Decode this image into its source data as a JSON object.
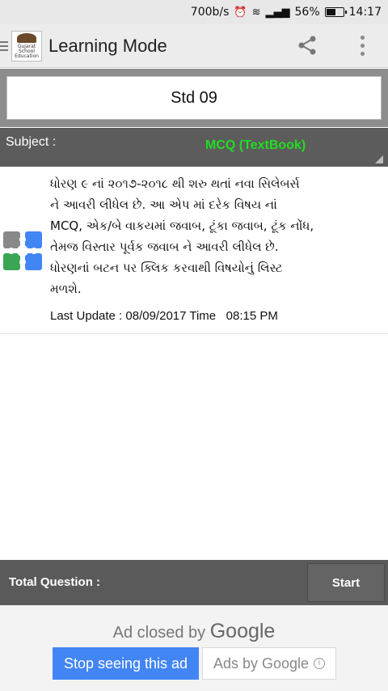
{
  "status_bar": {
    "speed": "700b/s",
    "battery": "56%",
    "battery_level": 0.56,
    "time": "14:17"
  },
  "app_bar": {
    "logo_text": "Gujarat School Education",
    "title": "Learning Mode",
    "icons": [
      "menu-icon",
      "share-icon",
      "overflow-menu-icon"
    ]
  },
  "std_selector": {
    "value": "Std 09"
  },
  "subject": {
    "label": "Subject :",
    "value": "MCQ  (TextBook)",
    "value_color": "#22dd22"
  },
  "list_item": {
    "icon": "puzzle-icon",
    "description": "ધોરણ ૯ નાં ૨૦૧૭-૨૦૧૮ થી શરુ થતાં નવા સિલેબર્સ\nને આવરી લીધેલ છે. આ એપ માં દરેક વિષય નાં\nMCQ, એક/બે વાકયમાં જવાબ, ટૂંકા જવાબ, ટૂંક નોંધ,\nતેમજ વિસ્તાર પૂર્વક જવાબ ને આવરી લીધેલ છે.\nધોરણનાં બટન પર ક્લિક કરવાથી વિષયોનું લિસ્ટ\nમળશે.",
    "last_update": "Last Update : 08/09/2017 Time   08:15 PM"
  },
  "bottom_bar": {
    "total_label": "Total Question :",
    "start_label": "Start"
  },
  "ad": {
    "closed_text": "Ad closed by",
    "brand": "Google",
    "stop_label": "Stop seeing this ad",
    "ads_by_label": "Ads by Google",
    "accent": "#4285f4"
  }
}
